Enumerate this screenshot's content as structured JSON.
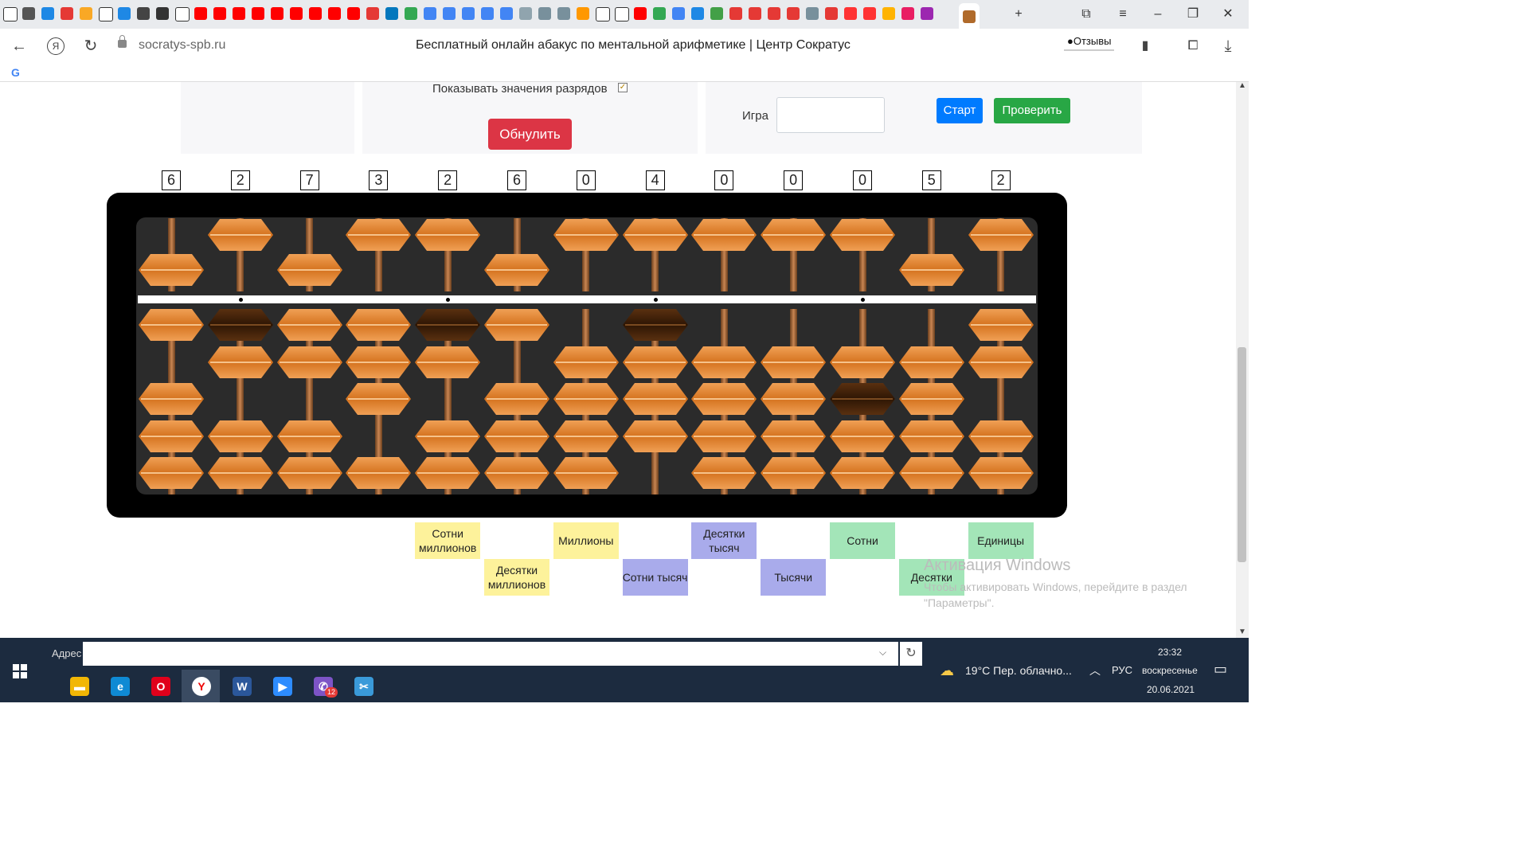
{
  "browser": {
    "url_domain": "socratys-spb.ru",
    "page_title": "Бесплатный онлайн абакус по ментальной арифметике | Центр Сократус",
    "reviews_label": "Отзывы",
    "tab_icons": [
      "page",
      "mail",
      "check",
      "mixed",
      "chart",
      "page",
      "check",
      "vk",
      "serif",
      "page",
      "youtube",
      "youtube",
      "youtube",
      "youtube",
      "youtube",
      "youtube",
      "youtube",
      "youtube",
      "youtube",
      "mail-red",
      "book",
      "drive",
      "doc",
      "doc",
      "doc",
      "doc",
      "doc",
      "photo",
      "person",
      "person",
      "send",
      "page",
      "page",
      "youtube",
      "drive",
      "doc",
      "edge",
      "puzzle",
      "mail-red",
      "mail-red",
      "mail-red",
      "mail-red",
      "person",
      "mail-red",
      "ya",
      "ya",
      "sun",
      "opera",
      "purple",
      "owl",
      "custom"
    ]
  },
  "controls": {
    "show_values_label": "Показывать значения разрядов",
    "show_values_checked": true,
    "reset_label": "Обнулить",
    "game_label": "Игра",
    "game_value": "",
    "start_label": "Старт",
    "check_label": "Проверить"
  },
  "abacus": {
    "digits": [
      "6",
      "2",
      "7",
      "3",
      "2",
      "6",
      "0",
      "4",
      "0",
      "0",
      "0",
      "5",
      "2"
    ],
    "bead_color": "#e58a3c",
    "highlight_color": "#4a2a0a"
  },
  "place_labels": [
    {
      "text": "Сотни миллионов",
      "color": "#fdf29b",
      "row": 0,
      "col": 4
    },
    {
      "text": "Десятки миллионов",
      "color": "#fdf29b",
      "row": 1,
      "col": 5
    },
    {
      "text": "Миллионы",
      "color": "#fdf29b",
      "row": 0,
      "col": 6
    },
    {
      "text": "Сотни тысяч",
      "color": "#a9abeb",
      "row": 1,
      "col": 7
    },
    {
      "text": "Десятки тысяч",
      "color": "#a9abeb",
      "row": 0,
      "col": 8
    },
    {
      "text": "Тысячи",
      "color": "#a9abeb",
      "row": 1,
      "col": 9
    },
    {
      "text": "Сотни",
      "color": "#a3e5b8",
      "row": 0,
      "col": 10
    },
    {
      "text": "Десятки",
      "color": "#a3e5b8",
      "row": 1,
      "col": 11
    },
    {
      "text": "Единицы",
      "color": "#a3e5b8",
      "row": 0,
      "col": 12
    }
  ],
  "windows_activation": {
    "title": "Активация Windows",
    "text": "Чтобы активировать Windows, перейдите в раздел \"Параметры\"."
  },
  "taskbar": {
    "address_label": "Адрес",
    "weather": "19°C  Пер. облачно...",
    "lang": "РУС",
    "time": "23:32",
    "day": "воскресенье",
    "date": "20.06.2021",
    "viber_badge": "12",
    "apps": [
      "file-explorer",
      "edge",
      "opera",
      "yandex-browser",
      "word",
      "zoom",
      "viber",
      "snipping-tool"
    ]
  }
}
